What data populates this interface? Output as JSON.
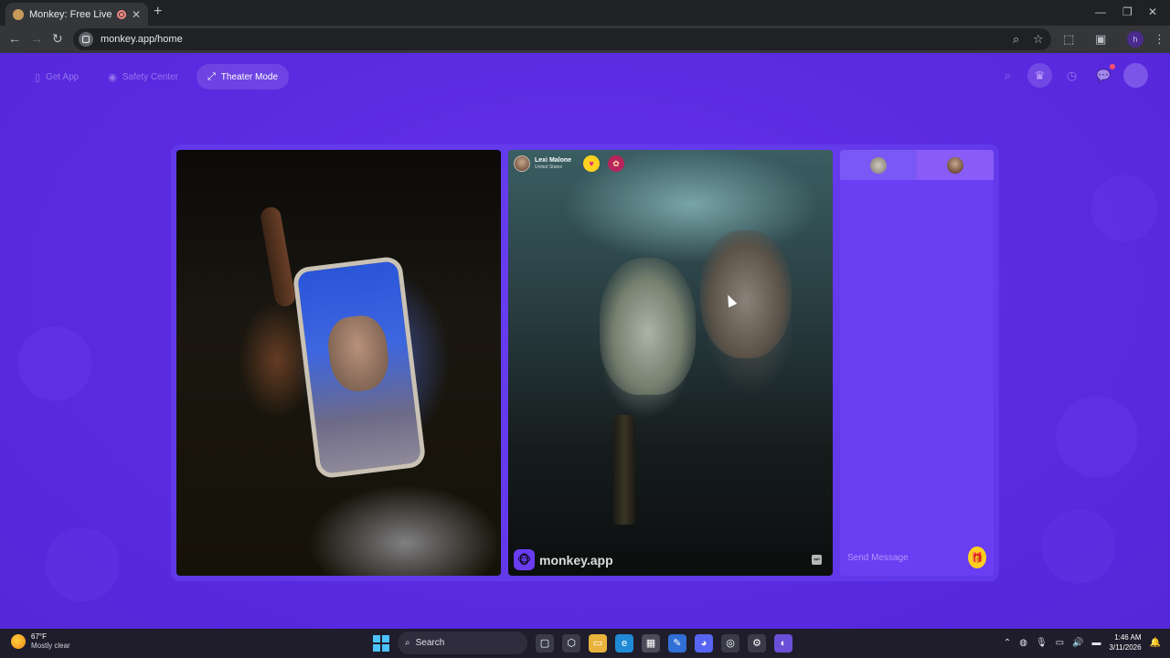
{
  "browser": {
    "tab_title": "Monkey: Free Live Video Ch",
    "url": "monkey.app/home",
    "new_tab": "+",
    "close": "✕"
  },
  "nav": {
    "get_app": "Get App",
    "safety_center": "Safety Center",
    "theater_mode": "Theater Mode"
  },
  "remote_user": {
    "name": "Lexi Malone",
    "country": "United States"
  },
  "watermark": "monkey.app",
  "chat": {
    "placeholder": "Send Message"
  },
  "taskbar": {
    "temperature": "67°F",
    "weather": "Mostly clear",
    "search": "Search",
    "time": "1:46 AM",
    "date": "3/11/2026"
  },
  "colors": {
    "page_bg": "#5b2be0",
    "chat_bg": "#6a3ef2",
    "gift_button": "#ffcf1f"
  },
  "icons": [
    "phone-icon",
    "shield-icon",
    "expand-icon",
    "search-icon",
    "crown-icon",
    "history-icon",
    "chat-icon",
    "gift-icon",
    "heart-icon",
    "flower-icon"
  ]
}
